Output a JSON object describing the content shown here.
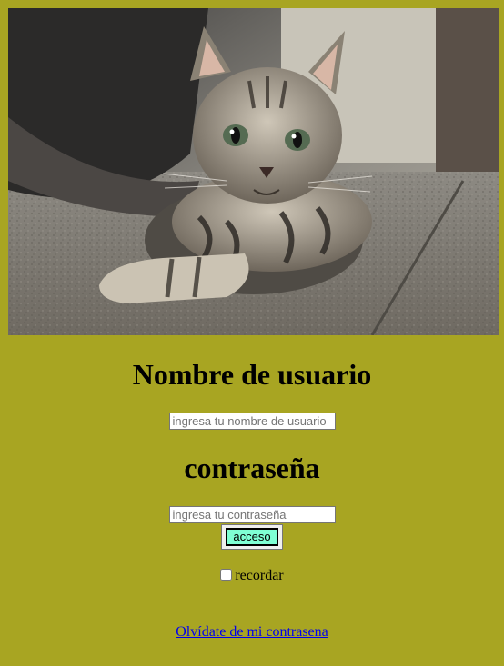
{
  "hero_image": {
    "icon": "kitten-photo"
  },
  "username": {
    "heading": "Nombre de usuario",
    "placeholder": "ingresa tu nombre de usuario",
    "value": ""
  },
  "password": {
    "heading": "contraseña",
    "placeholder": "ingresa tu contraseña",
    "value": ""
  },
  "submit": {
    "label": "acceso",
    "color": "#7fffd4"
  },
  "remember": {
    "label": "recordar",
    "checked": false
  },
  "forgot": {
    "label": "Olvídate de mi contrasena"
  },
  "theme": {
    "background": "#a8a522",
    "link": "#0000ee"
  }
}
